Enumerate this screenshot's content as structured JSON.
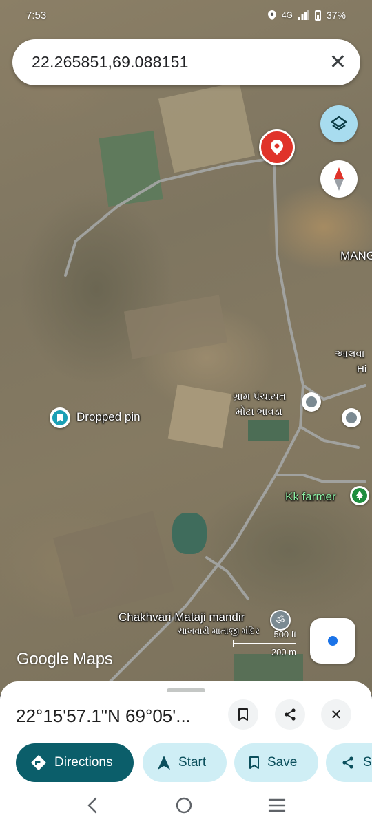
{
  "status_bar": {
    "time": "7:53",
    "network": "4G",
    "battery": "37%"
  },
  "search": {
    "query": "22.265851,69.088151"
  },
  "map_labels": {
    "dropped_pin": "Dropped pin",
    "gram_panchayat_line1": "ગ્રામ પંચાયત",
    "gram_panchayat_line2": "મોટા ભાવડા",
    "kk_farmer": "Kk farmer",
    "temple_en": "Chakhvari Mataji mandir",
    "temple_gu": "ચાખવારી માતાજી મંદિર",
    "partial_mang": "MANG",
    "partial_alav": "આલવા",
    "partial_hi": "Hi"
  },
  "map_attribution": "Google Maps",
  "scale": {
    "feet": "500 ft",
    "meters": "200 m"
  },
  "sheet": {
    "coords": "22°15'57.1\"N 69°05'...",
    "buttons": {
      "directions": "Directions",
      "start": "Start",
      "save": "Save",
      "share_partial": "S"
    }
  },
  "colors": {
    "pin_red": "#e0332a",
    "primary_teal": "#0b5e6a",
    "secondary_bg": "#cfeef5",
    "layers_bg": "#a8dcef"
  }
}
